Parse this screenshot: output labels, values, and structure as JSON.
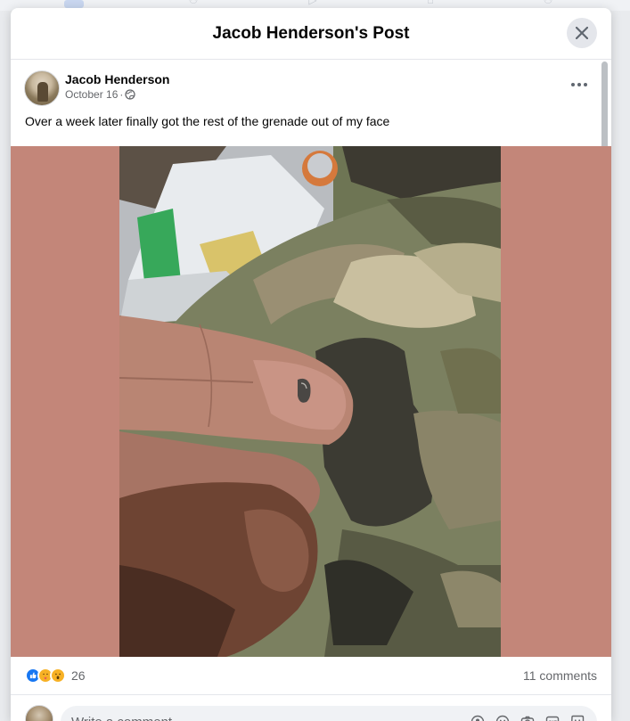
{
  "modal": {
    "title": "Jacob Henderson's Post"
  },
  "post": {
    "author": "Jacob Henderson",
    "date": "October 16",
    "separator": "·",
    "audience_icon": "globe-icon",
    "text": "Over a week later finally got the rest of the grenade out of my face",
    "photo_bg_color": "#c38679"
  },
  "reactions": {
    "icons": [
      "like-icon",
      "care-icon",
      "wow-icon"
    ],
    "count": "26",
    "comments": "11 comments"
  },
  "comment_input": {
    "placeholder": "Write a comment..."
  },
  "icons": {
    "close": "close-icon",
    "more": "more-options-icon",
    "comment_tools": [
      "avatar-sticker-icon",
      "emoji-icon",
      "camera-icon",
      "gif-icon",
      "sticker-icon"
    ]
  },
  "colors": {
    "like": "#1877f2",
    "care": "#f7b125",
    "wow": "#f7b125",
    "text": "#050505",
    "meta": "#65676b"
  }
}
